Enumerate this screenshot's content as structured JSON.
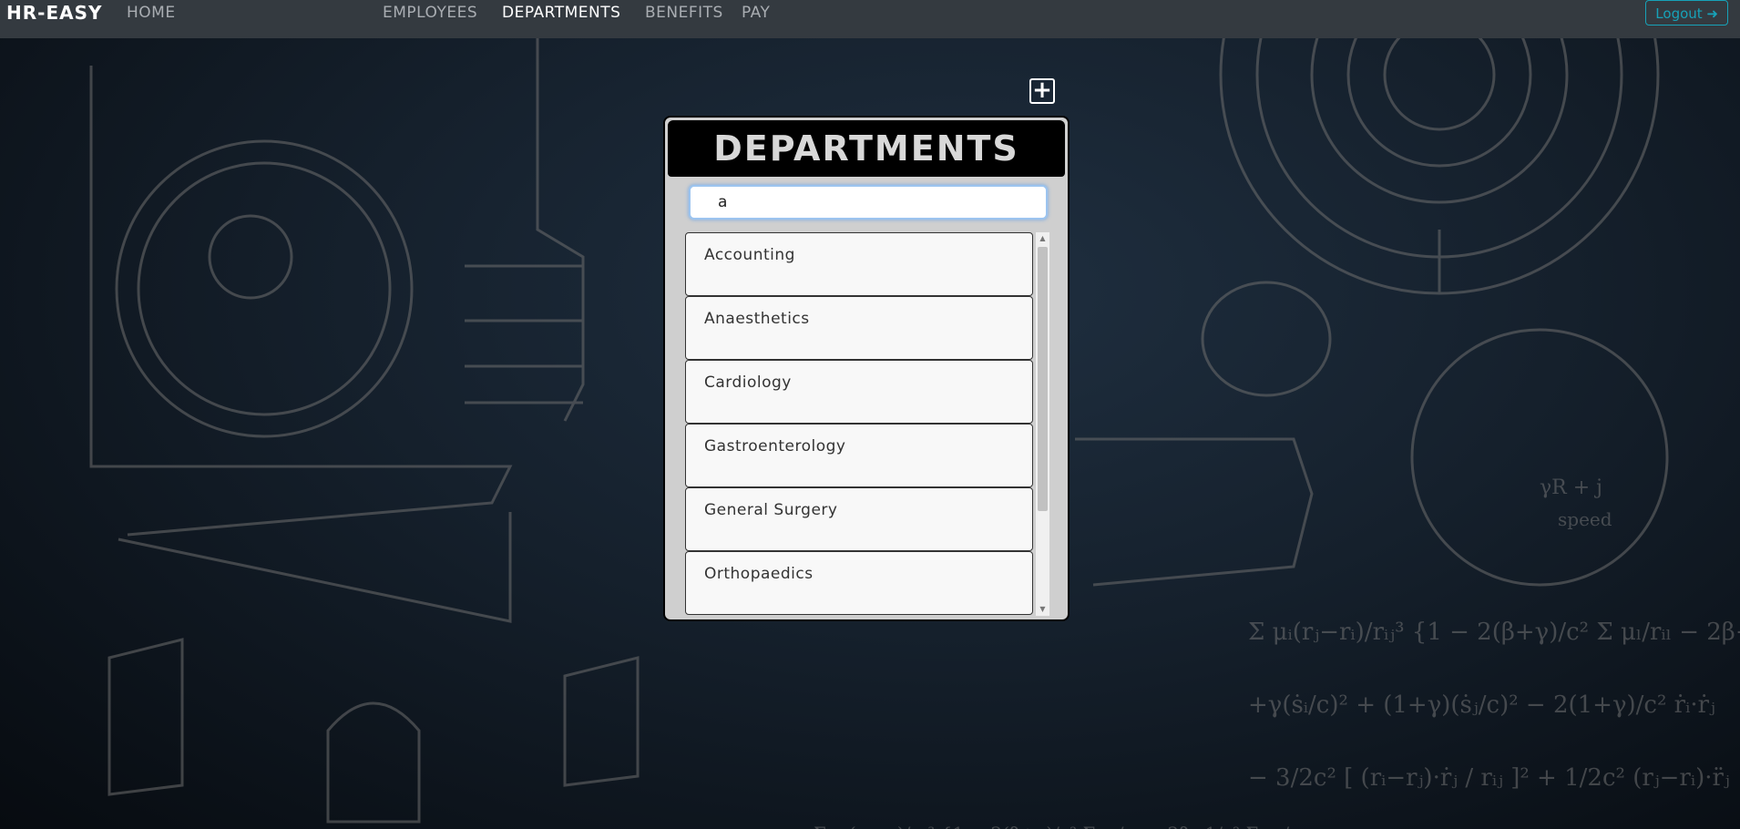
{
  "navbar": {
    "brand": "HR-EASY",
    "home": "HOME",
    "links": [
      "EMPLOYEES",
      "DEPARTMENTS",
      "BENEFITS",
      "PAY"
    ],
    "active": "DEPARTMENTS",
    "logout": "Logout ➜"
  },
  "panel": {
    "title": "DEPARTMENTS",
    "add_icon": "+",
    "search_value": "a",
    "items": [
      "Accounting",
      "Anaesthetics",
      "Cardiology",
      "Gastroenterology",
      "General Surgery",
      "Orthopaedics"
    ]
  },
  "colors": {
    "navbar": "#343a40",
    "accent": "#17a2b8",
    "panel_header": "#000000"
  },
  "icons": [
    "plus-square-icon",
    "logout-icon",
    "scroll-up-icon",
    "scroll-down-icon"
  ]
}
